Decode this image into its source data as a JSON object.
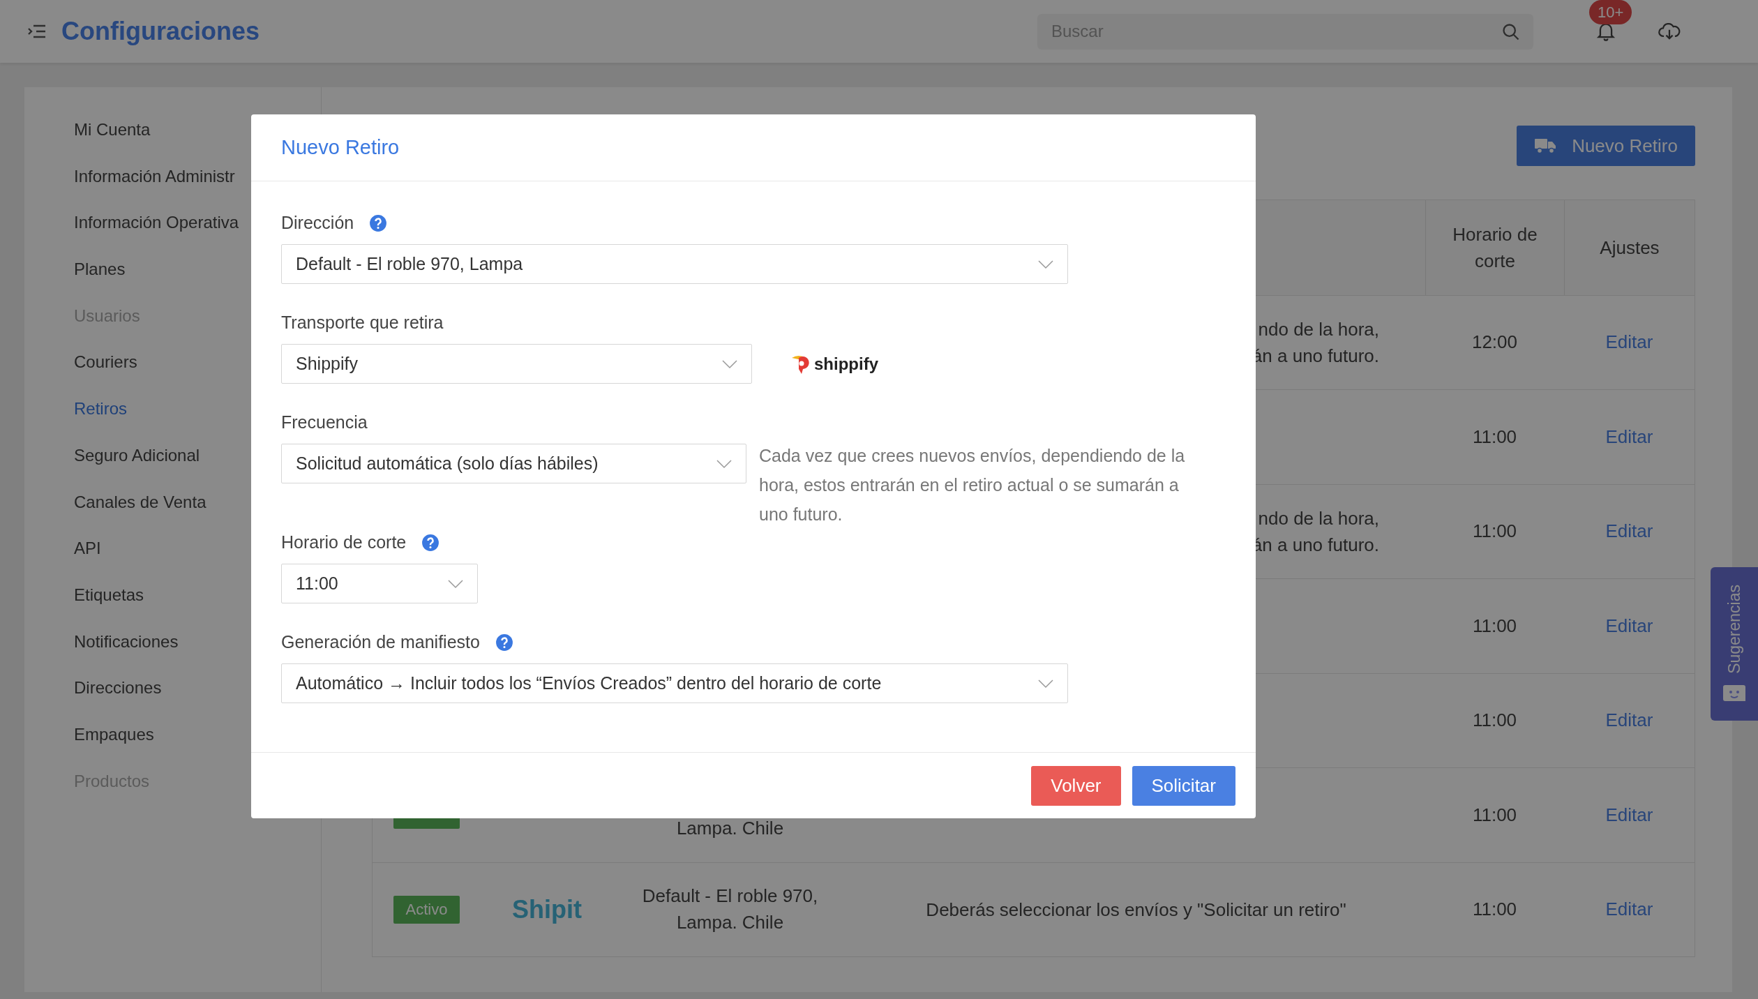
{
  "topbar": {
    "title": "Configuraciones",
    "search": {
      "placeholder": "Buscar"
    },
    "notifications_badge": "10+"
  },
  "sidebar": {
    "items": [
      {
        "label": "Mi Cuenta",
        "selected": false,
        "disabled": false
      },
      {
        "label": "Información Administr",
        "selected": false,
        "disabled": false
      },
      {
        "label": "Información Operativa",
        "selected": false,
        "disabled": false
      },
      {
        "label": "Planes",
        "selected": false,
        "disabled": false
      },
      {
        "label": "Usuarios",
        "selected": false,
        "disabled": true
      },
      {
        "label": "Couriers",
        "selected": false,
        "disabled": false
      },
      {
        "label": "Retiros",
        "selected": true,
        "disabled": false
      },
      {
        "label": "Seguro Adicional",
        "selected": false,
        "disabled": false
      },
      {
        "label": "Canales de Venta",
        "selected": false,
        "disabled": false
      },
      {
        "label": "API",
        "selected": false,
        "disabled": false
      },
      {
        "label": "Etiquetas",
        "selected": false,
        "disabled": false
      },
      {
        "label": "Notificaciones",
        "selected": false,
        "disabled": false
      },
      {
        "label": "Direcciones",
        "selected": false,
        "disabled": false
      },
      {
        "label": "Empaques",
        "selected": false,
        "disabled": false
      },
      {
        "label": "Productos",
        "selected": false,
        "disabled": true
      }
    ]
  },
  "page": {
    "new_button": "Nuevo Retiro",
    "table": {
      "columns": [
        "Horario de corte",
        "Ajustes"
      ],
      "rows": [
        {
          "description": [
            "ndo de la hora,",
            "án a uno futuro."
          ],
          "cutoff": "12:00",
          "action": "Editar"
        },
        {
          "cutoff": "11:00",
          "action": "Editar"
        },
        {
          "description": [
            "ndo de la hora,",
            "án a uno futuro."
          ],
          "cutoff": "11:00",
          "action": "Editar"
        },
        {
          "cutoff": "11:00",
          "action": "Editar"
        },
        {
          "cutoff": "11:00",
          "action": "Editar"
        },
        {
          "active": true,
          "address": "Lampa. Chile",
          "cutoff": "11:00",
          "action": "Editar"
        },
        {
          "active": true,
          "status": "Activo",
          "courier": "Shipit",
          "address": "Default - El roble 970, Lampa. Chile",
          "description": [
            "Deberás seleccionar los envíos y \"Solicitar un retiro\""
          ],
          "cutoff": "11:00",
          "action": "Editar"
        }
      ]
    }
  },
  "feedback_tab": {
    "label": "Sugerencias"
  },
  "modal": {
    "title": "Nuevo Retiro",
    "fields": [
      {
        "label": "Dirección",
        "help": true,
        "value": "Default - El roble 970, Lampa"
      },
      {
        "label": "Transporte que retira",
        "help": false,
        "value": "Shippify",
        "logo": "shippify"
      },
      {
        "label": "Frecuencia",
        "help": false,
        "value": "Solicitud automática (solo días hábiles)",
        "note": "Cada vez que crees nuevos envíos, dependiendo de la hora, estos entrarán en el retiro actual o se sumarán a uno futuro."
      },
      {
        "label": "Horario de corte",
        "help": true,
        "value": "11:00"
      },
      {
        "label": "Generación de manifiesto",
        "help": true,
        "value": "Automático → Incluir todos los “Envíos Creados” dentro del horario de corte"
      }
    ],
    "buttons": [
      {
        "label": "Volver",
        "kind": "danger"
      },
      {
        "label": "Solicitar",
        "kind": "primary"
      }
    ]
  }
}
